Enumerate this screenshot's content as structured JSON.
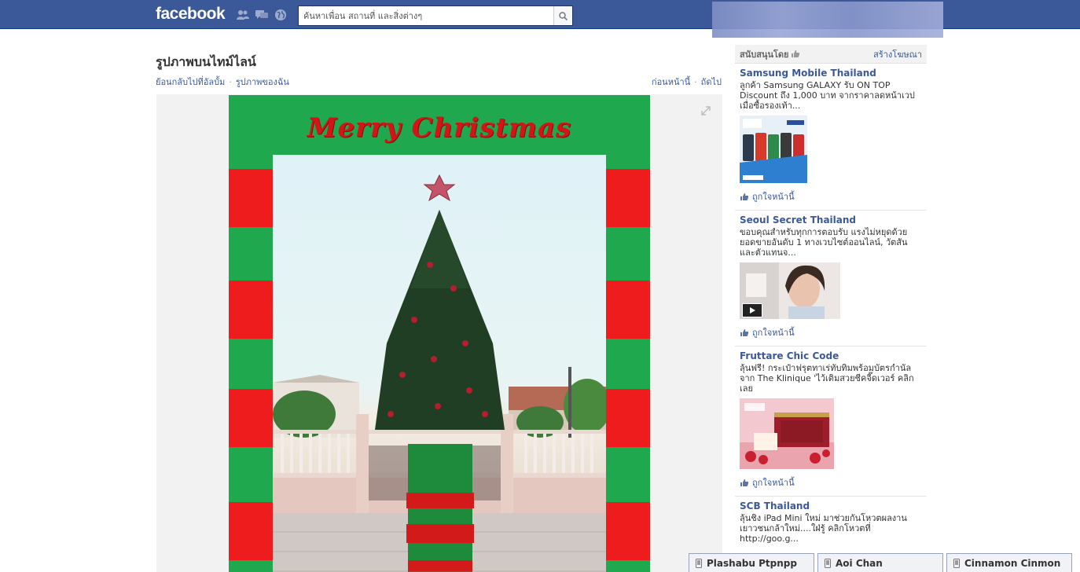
{
  "header": {
    "logo": "facebook",
    "search_placeholder": "ค้นหาเพื่อน สถานที่ และสิ่งต่างๆ"
  },
  "main": {
    "title": "รูปภาพบนไทม์ไลน์",
    "back_link": "ย้อนกลับไปที่อัลบั้ม",
    "my_photos_link": "รูปภาพของฉัน",
    "prev_link": "ก่อนหน้านี้",
    "next_link": "ถัดไป",
    "photo_caption": "Merry Christmas"
  },
  "sidebar": {
    "sponsored_label": "สนับสนุนโดย",
    "create_ad": "สร้างโฆษณา",
    "ads": [
      {
        "title": "Samsung Mobile Thailand",
        "body": "ลูกค้า Samsung GALAXY รับ ON TOP Discount ถึง 1,000 บาท จากราคาลดหน้าเวป เมื่อซื้อรองเท้า...",
        "like": "ถูกใจหน้านี้"
      },
      {
        "title": "Seoul Secret Thailand",
        "body": "ขอบคุณสำหรับทุกการตอบรับ แรงไม่หยุดด้วยยอดขายอันดับ 1 ทางเวบไซต์ออนไลน์, วัตสัน และตัวแทนจ...",
        "like": "ถูกใจหน้านี้"
      },
      {
        "title": "Fruttare Chic Code",
        "body": "ลุ้นฟรี! กระเป๋าฟรุตทาเร่ทับทิมพร้อมบัตรกำนัลจาก The Klinique 'ไว้เติมสวยชีคจี๊ดเวอร์ คลิกเลย",
        "like": "ถูกใจหน้านี้"
      },
      {
        "title": "SCB Thailand",
        "body": "ลุ้นชิง iPad Mini ใหม่ มาช่วยกันโหวตผลงานเยาวชนกล้าใหม่....ใฝ่รู้ คลิกโหวตที่ http://goo.g..."
      }
    ]
  },
  "chat": {
    "tabs": [
      "Plashabu Ptpnpp",
      "Aoi Chan",
      "Cinnamon Cinmon"
    ]
  }
}
